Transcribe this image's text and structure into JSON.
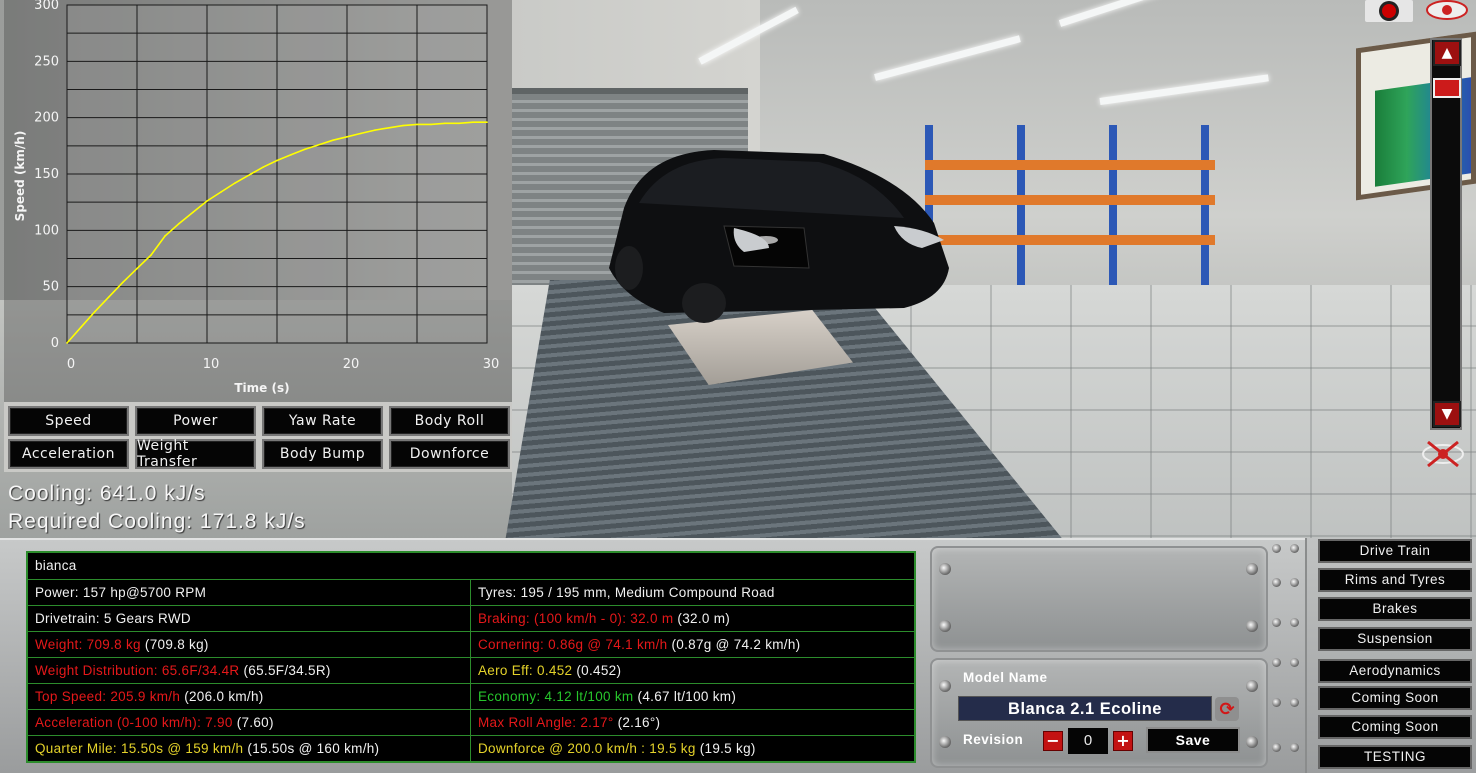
{
  "chart": {
    "xlabel": "Time (s)",
    "ylabel": "Speed (km/h)",
    "xticks": [
      "0",
      "10",
      "20",
      "30"
    ],
    "yticks": [
      "0",
      "50",
      "100",
      "150",
      "200",
      "250",
      "300"
    ]
  },
  "chart_data": {
    "type": "line",
    "title": "",
    "xlabel": "Time (s)",
    "ylabel": "Speed (km/h)",
    "xlim": [
      0,
      30
    ],
    "ylim": [
      0,
      300
    ],
    "grid": true,
    "line_color": "#ffff00",
    "x": [
      0,
      1,
      2,
      3,
      4,
      5,
      6,
      7,
      8,
      9,
      10,
      11,
      12,
      13,
      14,
      15,
      16,
      17,
      18,
      19,
      20,
      21,
      22,
      23,
      24,
      25,
      26,
      27,
      28,
      29,
      30
    ],
    "y": [
      0,
      14,
      28,
      41,
      54,
      66,
      78,
      95,
      106,
      116,
      126,
      134,
      142,
      149,
      156,
      162,
      167,
      172,
      176,
      180,
      183,
      186,
      189,
      191,
      193,
      194,
      194,
      195,
      195,
      196,
      196
    ]
  },
  "graph_buttons": [
    "Speed",
    "Power",
    "Yaw Rate",
    "Body Roll",
    "Acceleration",
    "Weight Transfer",
    "Body Bump",
    "Downforce"
  ],
  "cooling": {
    "current": "Cooling: 641.0 kJ/s",
    "required": "Required Cooling: 171.8 kJ/s"
  },
  "stats": {
    "car_name": "bianca",
    "rows": [
      {
        "left": [
          {
            "t": "Power: 157 hp@5700 RPM",
            "c": "w"
          }
        ],
        "right": [
          {
            "t": "Tyres: 195 / 195 mm, Medium Compound Road",
            "c": "w"
          }
        ]
      },
      {
        "left": [
          {
            "t": "Drivetrain: 5 Gears RWD",
            "c": "w"
          }
        ],
        "right": [
          {
            "t": "Braking: (100 km/h - 0): 32.0 m",
            "c": "red"
          },
          {
            "t": " (32.0 m)",
            "c": "w"
          }
        ]
      },
      {
        "left": [
          {
            "t": "Weight: 709.8 kg",
            "c": "red"
          },
          {
            "t": " (709.8 kg)",
            "c": "w"
          }
        ],
        "right": [
          {
            "t": "Cornering: 0.86g @ 74.1 km/h",
            "c": "red"
          },
          {
            "t": " (0.87g @ 74.2 km/h)",
            "c": "w"
          }
        ]
      },
      {
        "left": [
          {
            "t": "Weight Distribution: 65.6F/34.4R",
            "c": "red"
          },
          {
            "t": " (65.5F/34.5R)",
            "c": "w"
          }
        ],
        "right": [
          {
            "t": "Aero Eff: 0.452",
            "c": "yellow"
          },
          {
            "t": " (0.452)",
            "c": "w"
          }
        ]
      },
      {
        "left": [
          {
            "t": "Top Speed: 205.9 km/h",
            "c": "red"
          },
          {
            "t": " (206.0 km/h)",
            "c": "w"
          }
        ],
        "right": [
          {
            "t": "Economy: 4.12 lt/100 km",
            "c": "green"
          },
          {
            "t": " (4.67 lt/100 km)",
            "c": "w"
          }
        ]
      },
      {
        "left": [
          {
            "t": "Acceleration (0-100 km/h): 7.90",
            "c": "red"
          },
          {
            "t": " (7.60)",
            "c": "w"
          }
        ],
        "right": [
          {
            "t": "Max Roll Angle: 2.17°",
            "c": "red"
          },
          {
            "t": " (2.16°)",
            "c": "w"
          }
        ]
      },
      {
        "left": [
          {
            "t": "Quarter Mile: 15.50s @ 159 km/h",
            "c": "yellow"
          },
          {
            "t": " (15.50s @ 160 km/h)",
            "c": "w"
          }
        ],
        "right": [
          {
            "t": "Downforce @ 200.0 km/h : 19.5 kg",
            "c": "yellow"
          },
          {
            "t": " (19.5 kg)",
            "c": "w"
          }
        ]
      }
    ]
  },
  "model": {
    "model_name_label": "Model Name",
    "model_name": "Blanca 2.1 Ecoline",
    "revision_label": "Revision",
    "revision": "0",
    "minus": "−",
    "plus": "+",
    "save": "Save"
  },
  "side_buttons": [
    "Drive Train",
    "Rims and Tyres",
    "Brakes",
    "Suspension",
    "Aerodynamics",
    "Coming Soon",
    "Coming Soon",
    "TESTING"
  ],
  "colors": {
    "panel_border": "#2c8c2c",
    "warn_red": "#e5181a",
    "good_green": "#27c52c",
    "note_yellow": "#e4d22a",
    "model_name_bg": "#242c4a"
  }
}
